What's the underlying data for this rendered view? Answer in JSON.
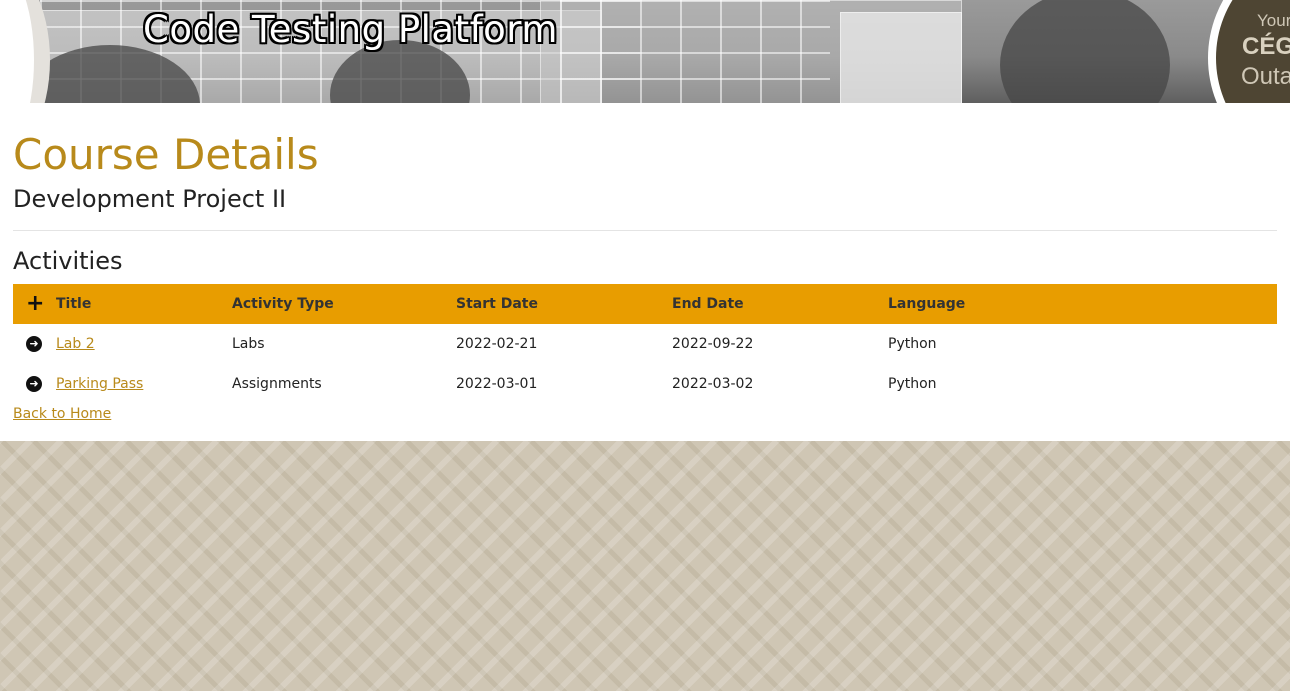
{
  "header": {
    "site_title": "Code Testing Platform",
    "brand": {
      "line1": "Your",
      "line2": "CÉG",
      "line3": "Outa"
    }
  },
  "page": {
    "title": "Course Details",
    "course_name": "Development Project II",
    "section_title": "Activities"
  },
  "table": {
    "columns": [
      "Title",
      "Activity Type",
      "Start Date",
      "End Date",
      "Language"
    ],
    "rows": [
      {
        "title": "Lab 2",
        "activity_type": "Labs",
        "start_date": "2022-02-21",
        "end_date": "2022-09-22",
        "language": "Python"
      },
      {
        "title": "Parking Pass",
        "activity_type": "Assignments",
        "start_date": "2022-03-01",
        "end_date": "2022-03-02",
        "language": "Python"
      }
    ]
  },
  "footer_links": {
    "back_label": "Back to Home"
  },
  "icons": {
    "add": "plus-icon",
    "row": "arrow-circle-right-icon"
  },
  "colors": {
    "accent": "#b88a1b",
    "table_header": "#e89d00",
    "brand_dark": "#4e4533"
  }
}
